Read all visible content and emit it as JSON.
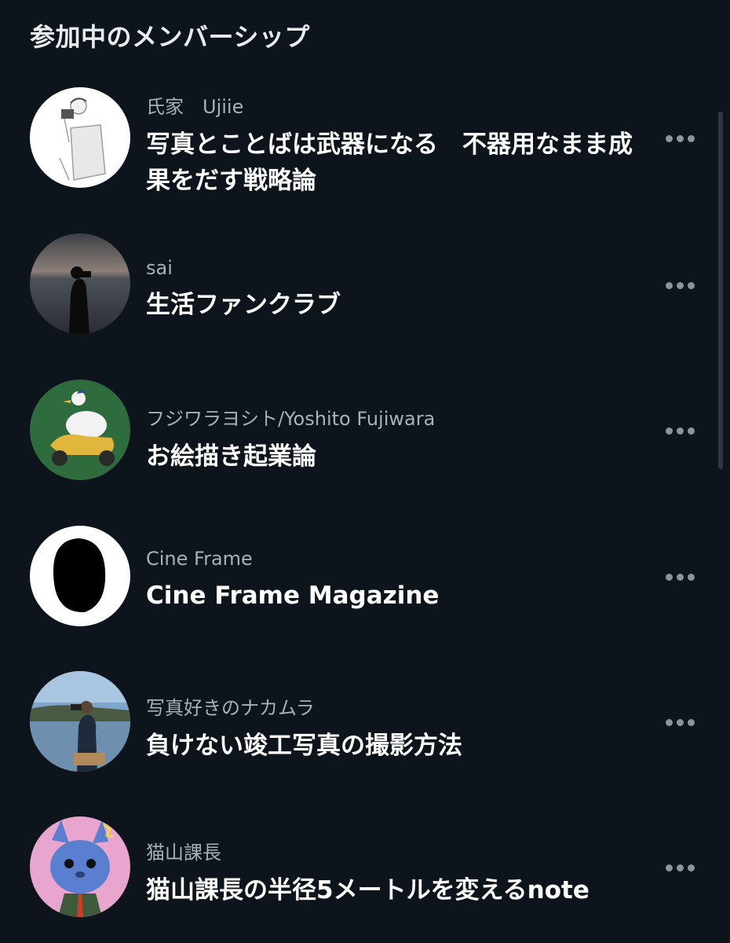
{
  "header": {
    "title": "参加中のメンバーシップ"
  },
  "memberships": [
    {
      "creator": "氏家　Ujiie",
      "title": "写真とことばは武器になる　不器用なまま成果をだす戦略論",
      "avatar": "illustrated-man-with-camera"
    },
    {
      "creator": "sai",
      "title": "生活ファンクラブ",
      "avatar": "silhouette-by-sea-photo"
    },
    {
      "creator": "フジワラヨシト/Yoshito Fujiwara",
      "title": "お絵描き起業論",
      "avatar": "duck-on-scooter-illustration"
    },
    {
      "creator": "Cine Frame",
      "title": "Cine Frame Magazine",
      "avatar": "black-oval-logo"
    },
    {
      "creator": "写真好きのナカムラ",
      "title": "負けない竣工写真の撮影方法",
      "avatar": "photographer-by-water-photo"
    },
    {
      "creator": "猫山課長",
      "title": "猫山課長の半径5メートルを変えるnote",
      "avatar": "blue-cat-in-suit-illustration"
    }
  ],
  "more_icon": "more-horizontal-icon",
  "colors": {
    "background": "#0d141b",
    "title": "#ffffff",
    "creator": "#a9b0b7",
    "dots": "#8d959c"
  }
}
